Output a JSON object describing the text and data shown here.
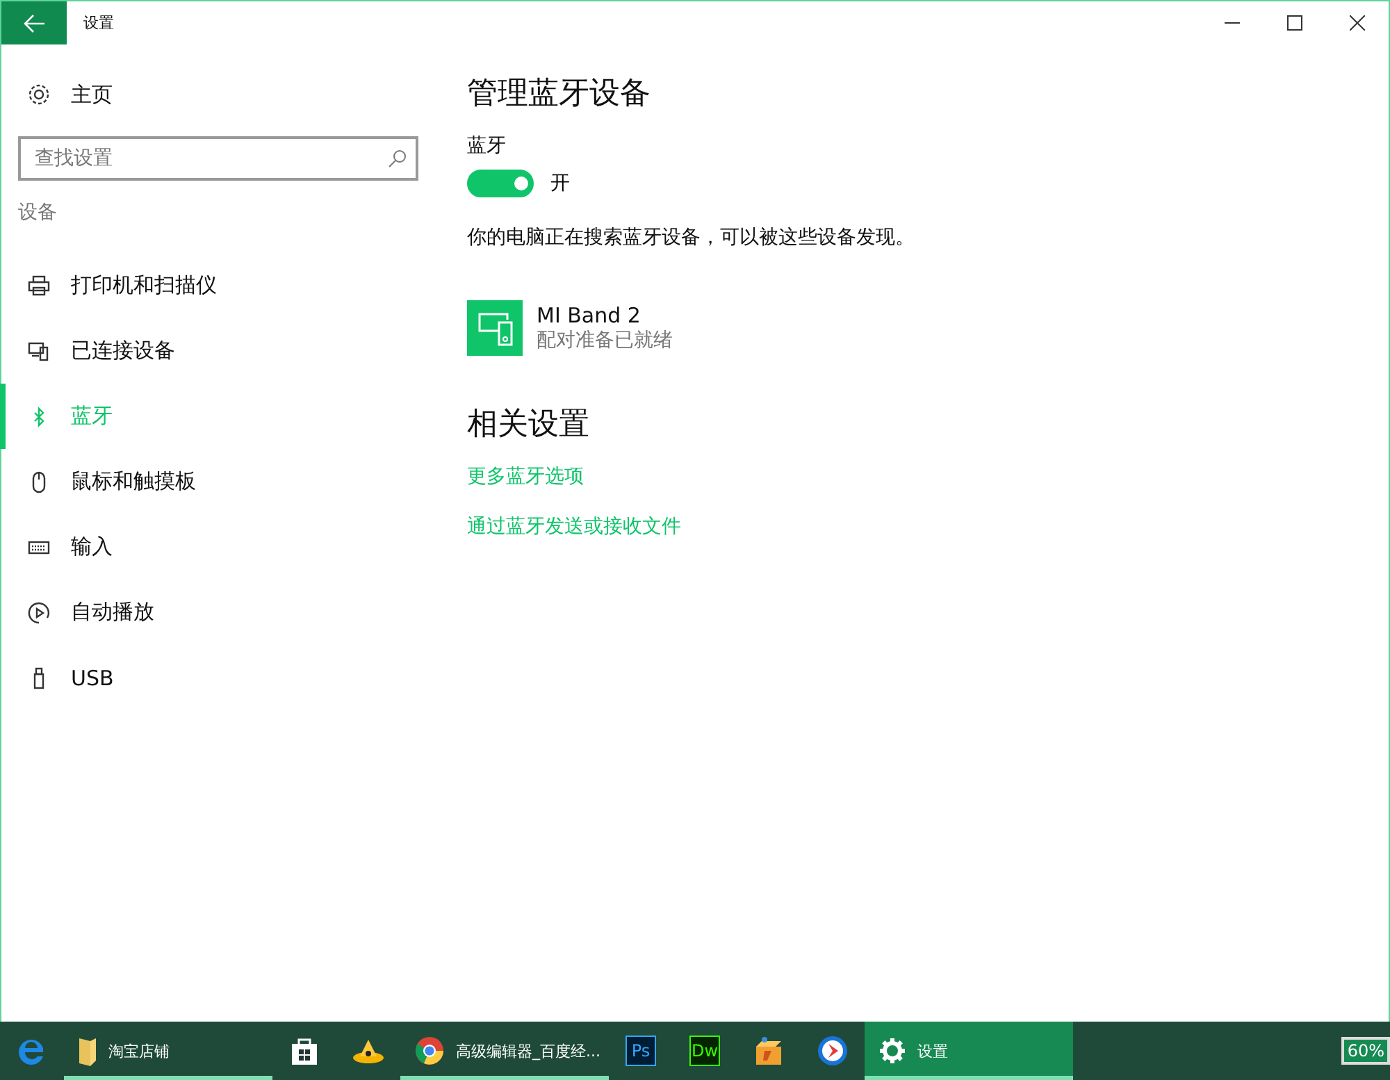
{
  "window": {
    "title": "设置"
  },
  "sidebar": {
    "home": "主页",
    "search": {
      "placeholder": "查找设置"
    },
    "section": "设备",
    "items": [
      {
        "label": "打印机和扫描仪",
        "kind": "printer",
        "selected": false
      },
      {
        "label": "已连接设备",
        "kind": "devices",
        "selected": false
      },
      {
        "label": "蓝牙",
        "kind": "bluetooth",
        "selected": true
      },
      {
        "label": "鼠标和触摸板",
        "kind": "mouse",
        "selected": false
      },
      {
        "label": "输入",
        "kind": "keyboard",
        "selected": false
      },
      {
        "label": "自动播放",
        "kind": "autoplay",
        "selected": false
      },
      {
        "label": "USB",
        "kind": "usb",
        "selected": false
      }
    ]
  },
  "main": {
    "title": "管理蓝牙设备",
    "toggle": {
      "label": "蓝牙",
      "on": true,
      "state_text": "开"
    },
    "description": "你的电脑正在搜索蓝牙设备，可以被这些设备发现。",
    "devices": [
      {
        "name": "MI Band 2",
        "status": "配对准备已就绪"
      }
    ],
    "related_title": "相关设置",
    "links": [
      "更多蓝牙选项",
      "通过蓝牙发送或接收文件"
    ]
  },
  "taskbar": {
    "items": [
      {
        "kind": "edge",
        "running": false,
        "selected": false
      },
      {
        "kind": "folder",
        "label": "淘宝店铺",
        "running": true,
        "selected": false
      },
      {
        "kind": "store",
        "running": false,
        "selected": false
      },
      {
        "kind": "hat",
        "running": false,
        "selected": false
      },
      {
        "kind": "chrome",
        "label": "高级编辑器_百度经...",
        "running": true,
        "selected": false
      },
      {
        "kind": "badge",
        "badge_text": "Ps",
        "running": false,
        "selected": false
      },
      {
        "kind": "badge",
        "badge_text": "Dw",
        "running": false,
        "selected": false
      },
      {
        "kind": "box",
        "running": false,
        "selected": false
      },
      {
        "kind": "player",
        "running": false,
        "selected": false
      },
      {
        "kind": "gear",
        "label": "设置",
        "running": true,
        "selected": true
      }
    ],
    "battery": "60%"
  }
}
